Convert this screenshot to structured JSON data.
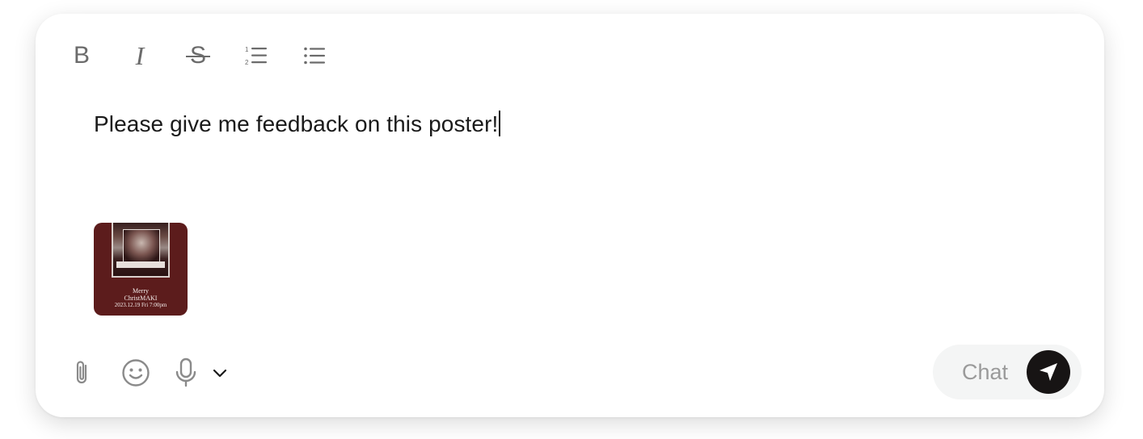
{
  "toolbar": {
    "buttons": [
      {
        "icon": "bold-icon",
        "glyph": "B"
      },
      {
        "icon": "italic-icon",
        "glyph": "I"
      },
      {
        "icon": "strikethrough-icon",
        "glyph": "S"
      },
      {
        "icon": "numbered-list-icon"
      },
      {
        "icon": "bulleted-list-icon"
      }
    ]
  },
  "editor": {
    "text": "Please give me feedback on this poster!"
  },
  "attachment": {
    "kind": "image",
    "poster_lines": [
      "Merry",
      "ChristMAKI",
      "2023.12.19 Fri 7:00pm"
    ]
  },
  "bottom_bar": {
    "icons": [
      "paperclip-icon",
      "smiley-icon",
      "microphone-icon",
      "chevron-down-icon"
    ]
  },
  "send": {
    "label": "Chat",
    "icon": "send-arrow-icon"
  },
  "colors": {
    "toolbar_icon": "#6b6b6b",
    "muted_icon": "#8a8a8a",
    "pill_bg": "#f4f5f5",
    "send_bg": "#171414",
    "poster_bg": "#5c1c1c"
  }
}
